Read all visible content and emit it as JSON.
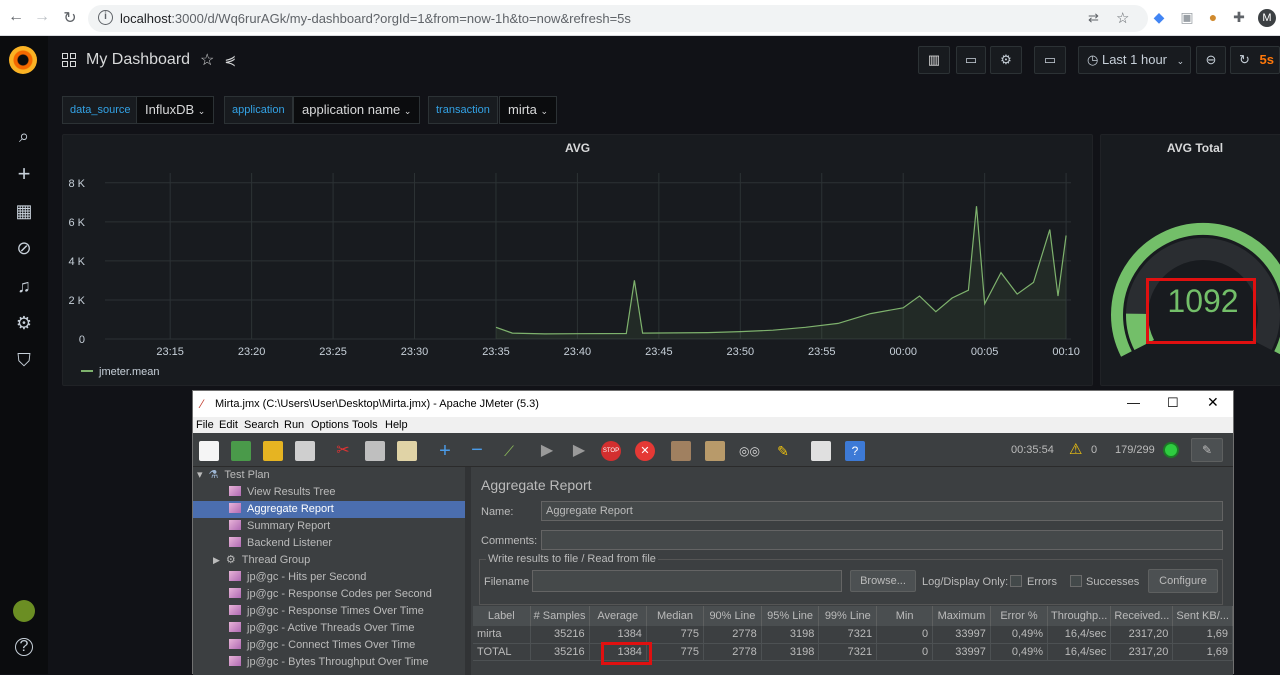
{
  "browser": {
    "url_host": "localhost",
    "url_rest": ":3000/d/Wq6rurAGk/my-dashboard?orgId=1&from=now-1h&to=now&refresh=5s",
    "profile_initial": "M"
  },
  "dashboard": {
    "title": "My Dashboard",
    "time_range": "Last 1 hour",
    "refresh": "5s",
    "variables": [
      {
        "label": "data_source",
        "value": "InfluxDB"
      },
      {
        "label": "application",
        "value": "application name"
      },
      {
        "label": "transaction",
        "value": "mirta"
      }
    ]
  },
  "chart_data": [
    {
      "type": "line",
      "title": "AVG",
      "y_ticks": [
        "8 K",
        "6 K",
        "4 K",
        "2 K",
        "0"
      ],
      "ylim": [
        0,
        8500
      ],
      "x_ticks": [
        "23:15",
        "23:20",
        "23:25",
        "23:30",
        "23:35",
        "23:40",
        "23:45",
        "23:50",
        "23:55",
        "00:00",
        "00:05",
        "00:10"
      ],
      "series": [
        {
          "name": "jmeter.mean",
          "color": "#7eb26d",
          "points": [
            [
              "23:35",
              600
            ],
            [
              "23:36",
              300
            ],
            [
              "23:38",
              260
            ],
            [
              "23:40",
              270
            ],
            [
              "23:43",
              280
            ],
            [
              "23:43:30",
              3000
            ],
            [
              "23:44",
              300
            ],
            [
              "23:46",
              310
            ],
            [
              "23:48",
              330
            ],
            [
              "23:50",
              380
            ],
            [
              "23:52",
              450
            ],
            [
              "23:54",
              600
            ],
            [
              "23:56",
              800
            ],
            [
              "23:58",
              1300
            ],
            [
              "00:00",
              1600
            ],
            [
              "00:01",
              2200
            ],
            [
              "00:02",
              1400
            ],
            [
              "00:03",
              2100
            ],
            [
              "00:04",
              2500
            ],
            [
              "00:04:30",
              6800
            ],
            [
              "00:05",
              1800
            ],
            [
              "00:06",
              3400
            ],
            [
              "00:07",
              2300
            ],
            [
              "00:08",
              2900
            ],
            [
              "00:09",
              5600
            ],
            [
              "00:09:30",
              2200
            ],
            [
              "00:10",
              5300
            ]
          ]
        }
      ]
    },
    {
      "type": "gauge",
      "title": "AVG Total",
      "value": 1092,
      "value_text": "1092",
      "color": "#73bf69"
    }
  ],
  "jmeter": {
    "title": "Mirta.jmx (C:\\Users\\User\\Desktop\\Mirta.jmx) - Apache JMeter (5.3)",
    "menu": [
      "File",
      "Edit",
      "Search",
      "Run",
      "Options",
      "Tools",
      "Help"
    ],
    "elapsed": "00:35:54",
    "warnings": "0",
    "threads": "179/299",
    "tree": [
      {
        "label": "Test Plan",
        "level": 0
      },
      {
        "label": "View Results Tree",
        "level": 1
      },
      {
        "label": "Aggregate Report",
        "level": 1,
        "selected": true
      },
      {
        "label": "Summary Report",
        "level": 1
      },
      {
        "label": "Backend Listener",
        "level": 1
      },
      {
        "label": "Thread Group",
        "level": 1
      },
      {
        "label": "jp@gc - Hits per Second",
        "level": 1
      },
      {
        "label": "jp@gc - Response Codes per Second",
        "level": 1
      },
      {
        "label": "jp@gc - Response Times Over Time",
        "level": 1
      },
      {
        "label": "jp@gc - Active Threads Over Time",
        "level": 1
      },
      {
        "label": "jp@gc - Connect Times Over Time",
        "level": 1
      },
      {
        "label": "jp@gc - Bytes Throughput Over Time",
        "level": 1
      }
    ],
    "panel": {
      "heading": "Aggregate Report",
      "name_label": "Name:",
      "name_value": "Aggregate Report",
      "comments_label": "Comments:",
      "write_results": "Write results to file / Read from file",
      "filename_label": "Filename",
      "browse": "Browse...",
      "log_display": "Log/Display Only:",
      "errors": "Errors",
      "successes": "Successes",
      "configure": "Configure"
    },
    "table": {
      "columns": [
        "Label",
        "# Samples",
        "Average",
        "Median",
        "90% Line",
        "95% Line",
        "99% Line",
        "Min",
        "Maximum",
        "Error %",
        "Throughp...",
        "Received...",
        "Sent KB/..."
      ],
      "rows": [
        [
          "mirta",
          "35216",
          "1384",
          "775",
          "2778",
          "3198",
          "7321",
          "0",
          "33997",
          "0,49%",
          "16,4/sec",
          "2317,20",
          "1,69"
        ],
        [
          "TOTAL",
          "35216",
          "1384",
          "775",
          "2778",
          "3198",
          "7321",
          "0",
          "33997",
          "0,49%",
          "16,4/sec",
          "2317,20",
          "1,69"
        ]
      ]
    }
  }
}
